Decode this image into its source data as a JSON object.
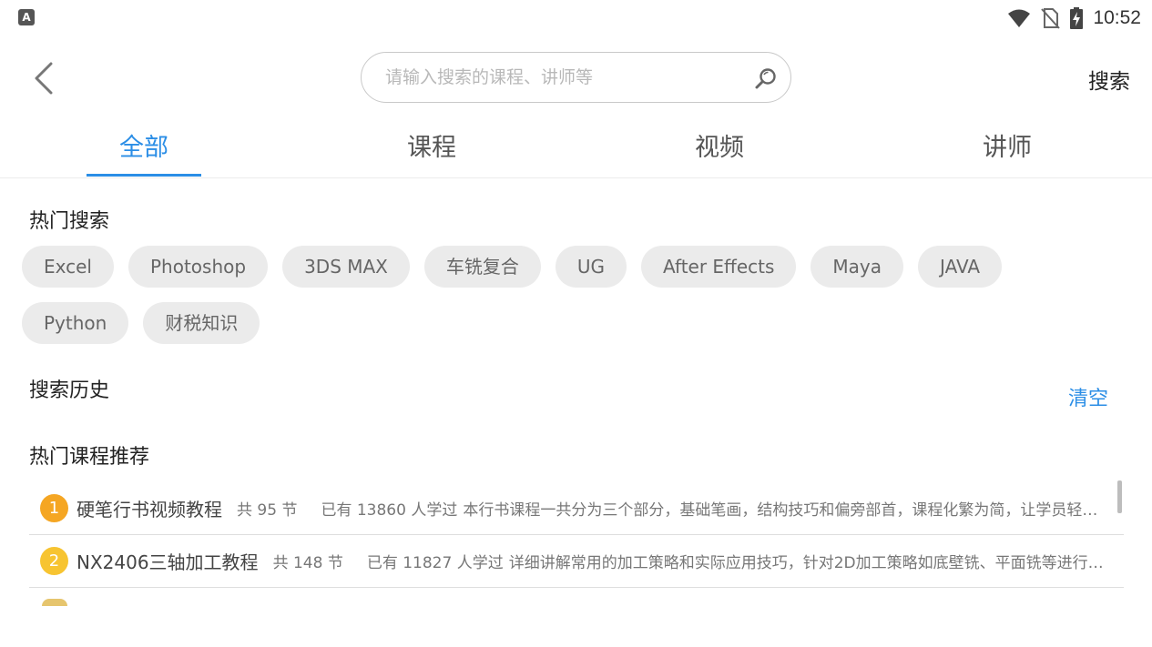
{
  "status_bar": {
    "time": "10:52",
    "app_icon_letter": "A"
  },
  "header": {
    "search_placeholder": "请输入搜索的课程、讲师等",
    "search_value": "",
    "search_button": "搜索"
  },
  "tabs": [
    {
      "label": "全部",
      "active": true
    },
    {
      "label": "课程",
      "active": false
    },
    {
      "label": "视频",
      "active": false
    },
    {
      "label": "讲师",
      "active": false
    }
  ],
  "hot_search": {
    "title": "热门搜索",
    "rows": [
      [
        "Excel",
        "Photoshop",
        "3DS MAX",
        "车铣复合",
        "UG",
        "After Effects",
        "Maya",
        "JAVA"
      ],
      [
        "Python",
        "财税知识"
      ]
    ]
  },
  "history": {
    "title": "搜索历史",
    "clear": "清空"
  },
  "recommend": {
    "title": "热门课程推荐",
    "items": [
      {
        "rank": "1",
        "rank_color": "#f5a623",
        "title": "硬笔行书视频教程",
        "lessons": "共 95 节",
        "learned": "已有  13860 人学过",
        "desc": "本行书课程一共分为三个部分，基础笔画，结构技巧和偏旁部首，课程化繁为简，让学员轻松掌握"
      },
      {
        "rank": "2",
        "rank_color": "#f7c431",
        "title": "NX2406三轴加工教程",
        "lessons": "共 148 节",
        "learned": "已有  11827 人学过",
        "desc": "详细讲解常用的加工策略和实际应用技巧，针对2D加工策略如底壁铣、平面铣等进行讲解"
      }
    ]
  },
  "colors": {
    "accent": "#2b8ee6",
    "chip_bg": "#ebebeb"
  }
}
